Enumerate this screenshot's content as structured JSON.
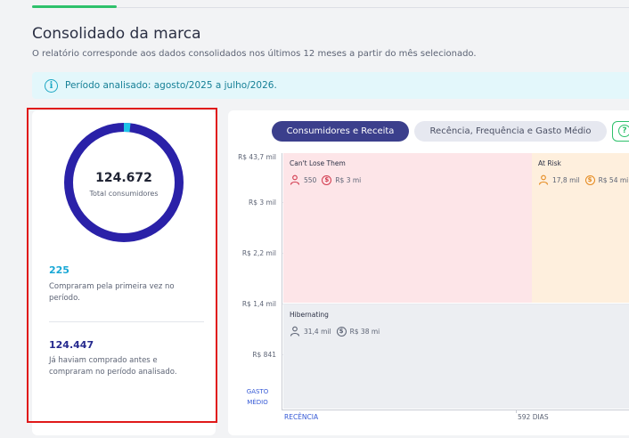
{
  "header": {
    "title": "Consolidado da marca",
    "subtitle": "O relatório corresponde aos dados consolidados nos últimos 12 meses a partir do mês selecionado."
  },
  "info_banner": {
    "icon": "info-icon",
    "text": "Período analisado: agosto/2025 a julho/2026."
  },
  "summary": {
    "total_value": "124.672",
    "total_label": "Total consumidores",
    "new_value": "225",
    "new_desc": "Compraram pela primeira vez no período.",
    "returning_value": "124.447",
    "returning_desc": "Já haviam comprado antes e compraram no período analisado.",
    "donut_new_fraction": 0.0018,
    "colors": {
      "donut_main": "#2a21a8",
      "donut_new": "#1ec4e8",
      "highlight": "#e01919"
    }
  },
  "chart_panel": {
    "tabs": [
      {
        "label": "Consumidores e Receita",
        "active": true
      },
      {
        "label": "Recência, Frequência e Gasto Médio",
        "active": false
      }
    ],
    "help_icon": "question-icon"
  },
  "chart_data": {
    "type": "heatmap",
    "y_ticks": [
      "R$ 43,7 mil",
      "R$ 3 mil",
      "R$ 2,2 mil",
      "R$ 1,4 mil",
      "R$ 841"
    ],
    "ylabel": "GASTO MÉDIO",
    "xlabel": "RECÊNCIA",
    "x_tick": "592 DIAS",
    "segments": [
      {
        "name": "Can't Lose Them",
        "consumers": "550",
        "revenue": "R$ 3 mi",
        "color": "#fde5e8",
        "accent": "#d23a4e"
      },
      {
        "name": "At Risk",
        "consumers": "17,8 mil",
        "revenue": "R$ 54 mi",
        "color": "#feefdd",
        "accent": "#e58a1f"
      },
      {
        "name": "Hibernating",
        "consumers": "31,4 mil",
        "revenue": "R$ 38 mi",
        "color": "#eceef2",
        "accent": "#5d6475"
      }
    ]
  }
}
